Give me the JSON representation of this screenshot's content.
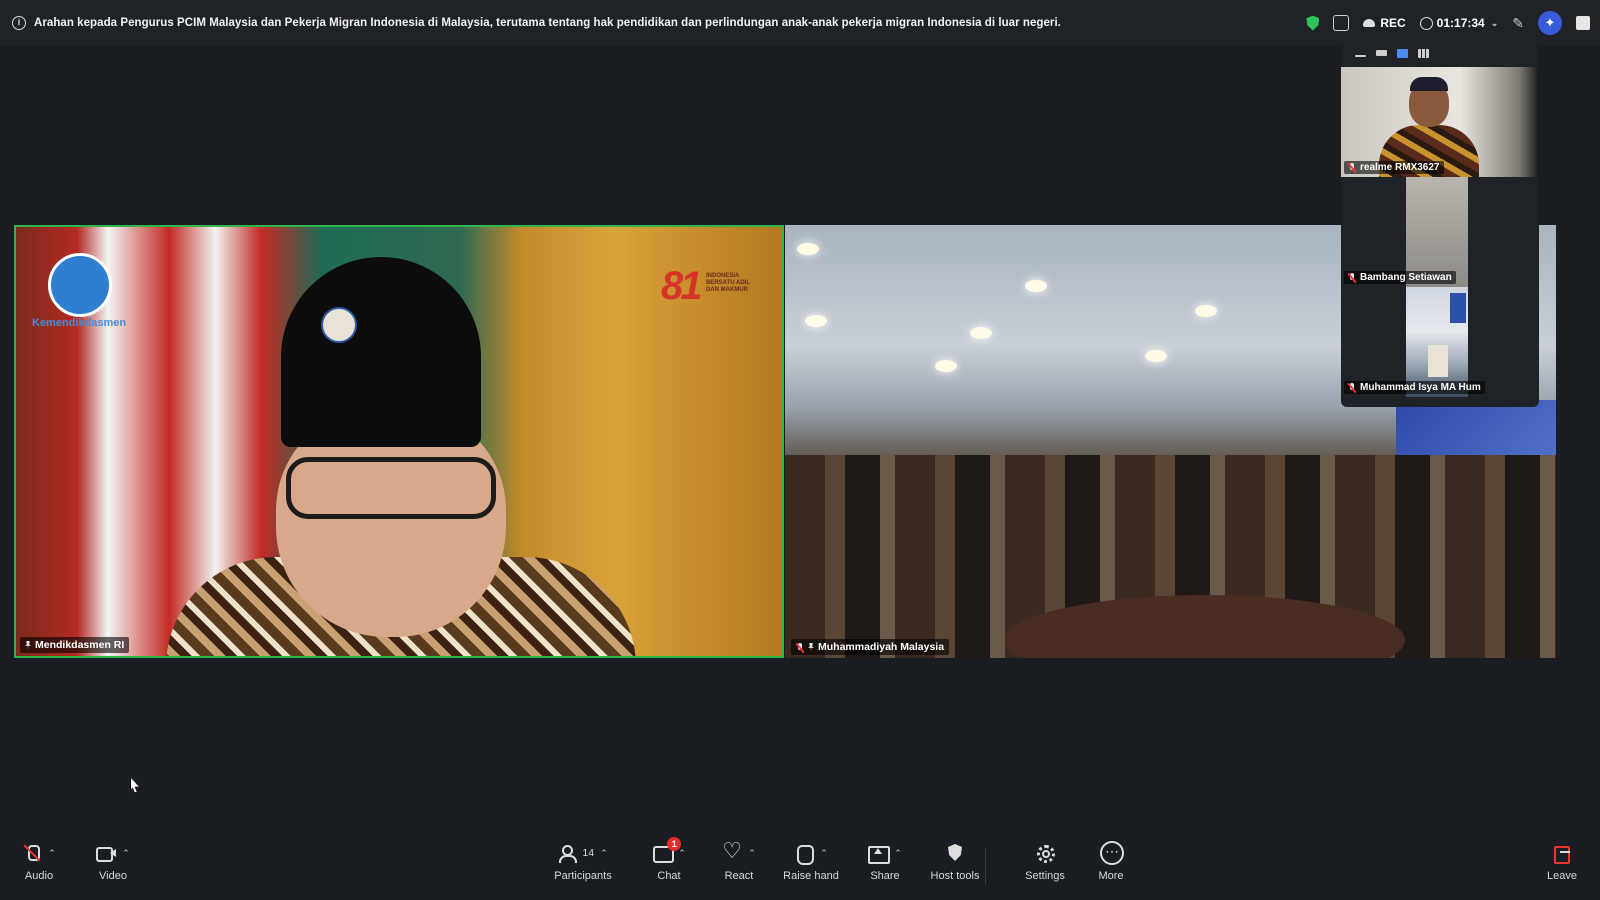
{
  "meeting": {
    "topic": "Arahan kepada Pengurus  PCIM Malaysia dan Pekerja  Migran Indonesia di Malaysia,  terutama tentang hak pendidikan  dan perlindungan anak-anak  pekerja migran Indonesia di luar  negeri.",
    "recording_label": "REC",
    "elapsed_time": "01:17:34"
  },
  "icons": {
    "info": "info-icon",
    "encryption": "shield-check-icon",
    "notes": "notes-icon",
    "cloud": "cloud-icon",
    "clock": "clock-icon",
    "annotate": "pencil-icon",
    "ai_companion": "sparkle-icon",
    "apps": "apps-icon"
  },
  "main_tiles": [
    {
      "name": "Mendikdasmen RI",
      "pinned": true,
      "muted": false,
      "active_speaker": true,
      "background_logo_text": "Kemendikdasmen",
      "background_badge_number": "81",
      "background_badge_text": "INDONESIA BERSATU ADIL DAN MAKMUR"
    },
    {
      "name": "Muhammadiyah Malaysia",
      "pinned": true,
      "muted": true,
      "active_speaker": false
    }
  ],
  "thumbnails": [
    {
      "name": "realme RMX3627",
      "muted": true
    },
    {
      "name": "Bambang Setiawan",
      "muted": true
    },
    {
      "name": "Muhammad Isya MA Hum",
      "muted": true
    }
  ],
  "toolbar": {
    "audio": "Audio",
    "video": "Video",
    "participants": "Participants",
    "participants_count": "14",
    "chat": "Chat",
    "chat_unread": "1",
    "react": "React",
    "raise_hand": "Raise hand",
    "share": "Share",
    "host_tools": "Host tools",
    "settings": "Settings",
    "more": "More",
    "leave": "Leave"
  },
  "colors": {
    "active_speaker_border": "#2fb54a",
    "recording_accent": "#e32b2b",
    "encryption_shield": "#2ec45b",
    "ai_button": "#3a5bd9"
  }
}
